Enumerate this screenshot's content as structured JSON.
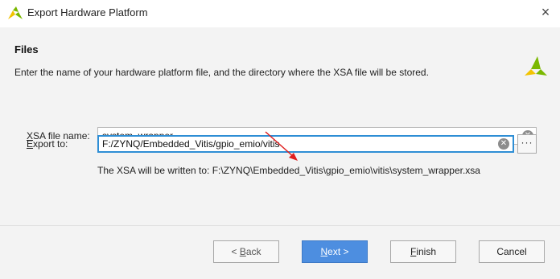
{
  "window": {
    "title": "Export Hardware Platform",
    "close_glyph": "×",
    "logo_icon": "vivado-logo-icon"
  },
  "page": {
    "heading": "Files",
    "description": "Enter the name of your hardware platform file, and the directory where the XSA file will be stored."
  },
  "fields": {
    "xsa_name": {
      "label_mnemonic": "X",
      "label_rest": "SA file name:",
      "value": "system_wrapper"
    },
    "export_to": {
      "label_mnemonic": "E",
      "label_rest": "xport to:",
      "value": "F:/ZYNQ/Embedded_Vitis/gpio_emio/vitis",
      "browse_label": "···"
    }
  },
  "note": "The XSA will be written to: F:\\ZYNQ\\Embedded_Vitis\\gpio_emio\\vitis\\system_wrapper.xsa",
  "buttons": {
    "back_prefix": "< ",
    "back_mnemonic": "B",
    "back_rest": "ack",
    "next_mnemonic": "N",
    "next_rest": "ext >",
    "finish_mnemonic": "F",
    "finish_rest": "inish",
    "cancel": "Cancel"
  },
  "colors": {
    "accent": "#4d8ee0",
    "focus_border": "#2e8ed5",
    "arrow": "#e02020",
    "logo_yellow": "#f2c300",
    "logo_green": "#7ab800"
  }
}
